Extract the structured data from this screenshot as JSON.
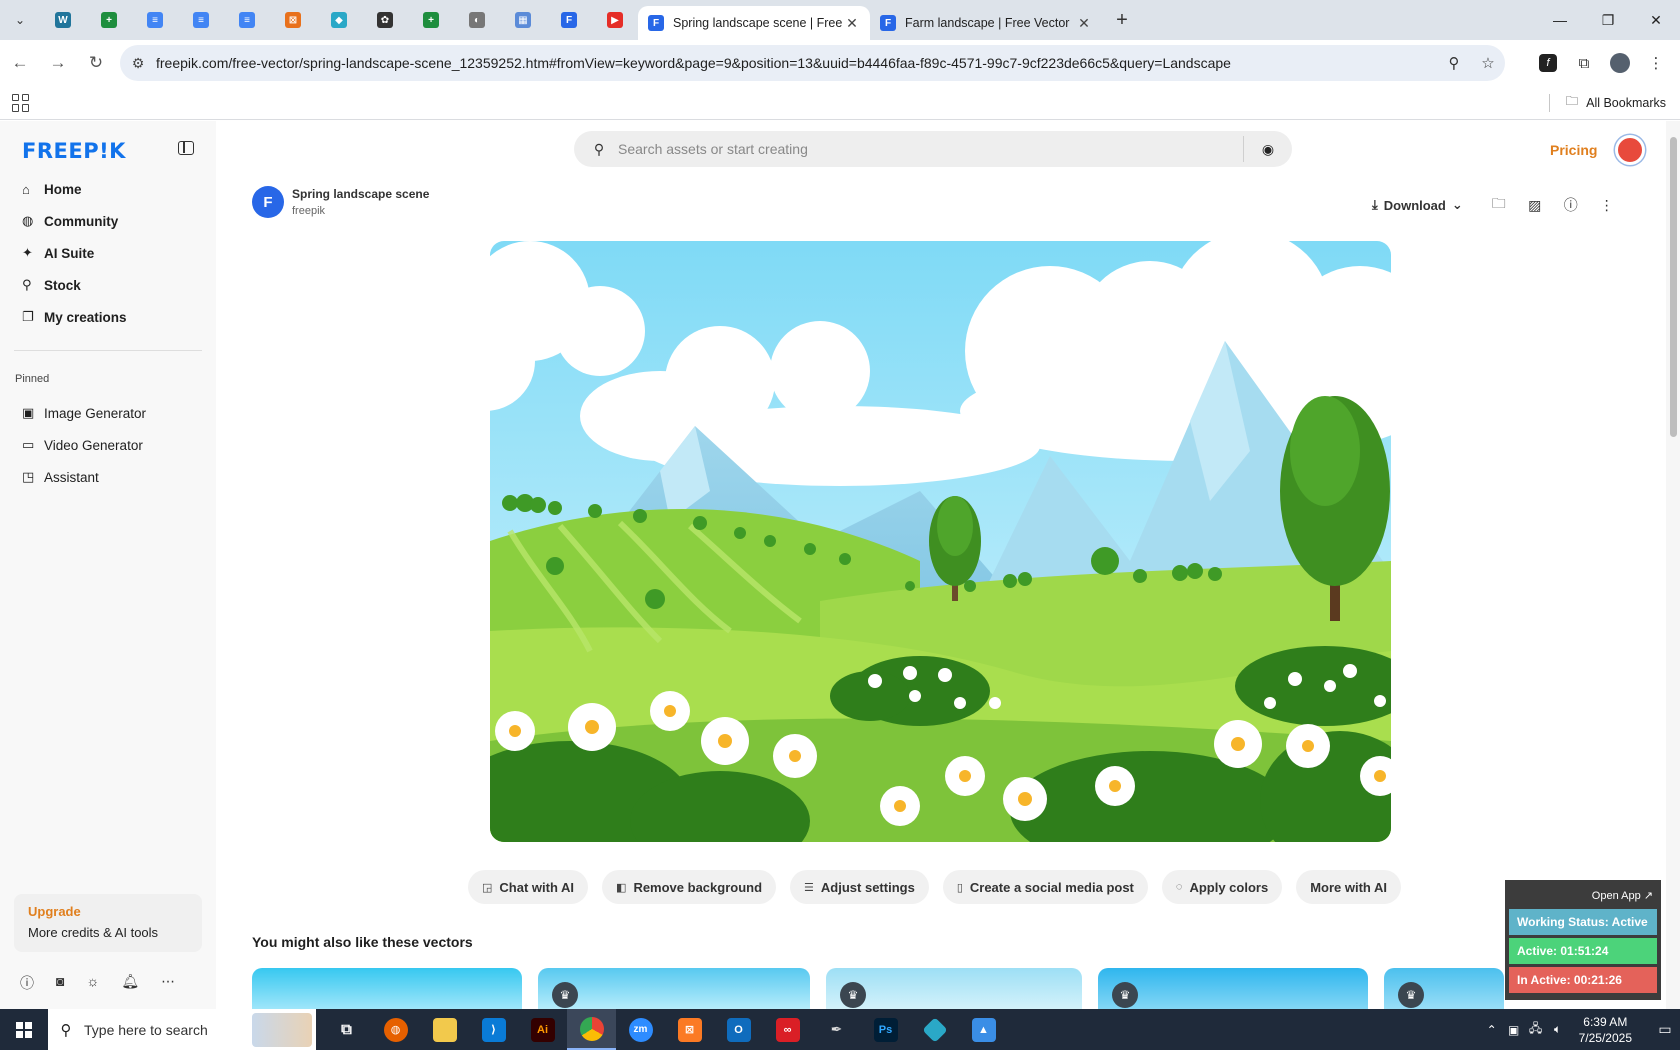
{
  "browser": {
    "pinned_tabs": [
      {
        "icon": "wordpress-icon",
        "color": "#21759b",
        "glyph": "W"
      },
      {
        "icon": "google-sheets-icon",
        "color": "#1e8e3e",
        "glyph": "+"
      },
      {
        "icon": "google-docs-icon",
        "color": "#4285f4",
        "glyph": "≡"
      },
      {
        "icon": "google-docs-icon",
        "color": "#4285f4",
        "glyph": "≡"
      },
      {
        "icon": "google-docs-icon",
        "color": "#4285f4",
        "glyph": "≡"
      },
      {
        "icon": "xampp-icon",
        "color": "#e8711c",
        "glyph": "⊠"
      },
      {
        "icon": "app-icon",
        "color": "#2aa8c7",
        "glyph": "◆"
      },
      {
        "icon": "chatgpt-icon",
        "color": "#333333",
        "glyph": "✿"
      },
      {
        "icon": "google-sheets-icon",
        "color": "#1e8e3e",
        "glyph": "+"
      },
      {
        "icon": "globe-icon",
        "color": "#777777",
        "glyph": "◐"
      },
      {
        "icon": "grid-app-icon",
        "color": "#5b8bd8",
        "glyph": "▦"
      },
      {
        "icon": "freepik-icon",
        "color": "#2867e7",
        "glyph": "F"
      },
      {
        "icon": "youtube-icon",
        "color": "#e52d27",
        "glyph": "▶"
      }
    ],
    "tabs": [
      {
        "title": "Spring landscape scene | Free V",
        "active": true
      },
      {
        "title": "Farm landscape | Free Vector",
        "active": false
      }
    ],
    "url": "freepik.com/free-vector/spring-landscape-scene_12359252.htm#fromView=keyword&page=9&position=13&uuid=b4446faa-f89c-4571-99c7-9cf223de66c5&query=Landscape",
    "all_bookmarks": "All Bookmarks"
  },
  "sidebar": {
    "logo": "FREEP!K",
    "nav": [
      {
        "label": "Home",
        "icon": "home-icon",
        "glyph": "⌂"
      },
      {
        "label": "Community",
        "icon": "globe-icon",
        "glyph": "◍"
      },
      {
        "label": "AI Suite",
        "icon": "sparkle-icon",
        "glyph": "✦"
      },
      {
        "label": "Stock",
        "icon": "search-icon",
        "glyph": "⚲"
      },
      {
        "label": "My creations",
        "icon": "creations-icon",
        "glyph": "❐"
      }
    ],
    "pinned_label": "Pinned",
    "pinned": [
      {
        "label": "Image Generator",
        "icon": "image-icon",
        "glyph": "▣"
      },
      {
        "label": "Video Generator",
        "icon": "video-icon",
        "glyph": "▭"
      },
      {
        "label": "Assistant",
        "icon": "chat-icon",
        "glyph": "◳"
      }
    ],
    "upgrade_title": "Upgrade",
    "upgrade_text": "More credits & AI tools"
  },
  "header": {
    "search_placeholder": "Search assets or start creating",
    "pricing": "Pricing"
  },
  "asset": {
    "title": "Spring landscape scene",
    "author": "freepik",
    "download": "Download"
  },
  "ai_actions": [
    {
      "label": "Chat with AI",
      "icon": "chat-icon",
      "glyph": "◲"
    },
    {
      "label": "Remove background",
      "icon": "remove-bg-icon",
      "glyph": "◧"
    },
    {
      "label": "Adjust settings",
      "icon": "sliders-icon",
      "glyph": "☰"
    },
    {
      "label": "Create a social media post",
      "icon": "phone-icon",
      "glyph": "▯"
    },
    {
      "label": "Apply colors",
      "icon": "palette-icon",
      "glyph": "◌"
    },
    {
      "label": "More with AI",
      "icon": "",
      "glyph": ""
    }
  ],
  "similar_heading": "You might also like these vectors",
  "tracker": {
    "open_app": "Open App ↗",
    "status": "Working Status: Active",
    "active": "Active: 01:51:24",
    "inactive": "In Active: 00:21:26",
    "colors": {
      "status": "#5fb3c9",
      "active": "#4cd37a",
      "inactive": "#e4625a"
    }
  },
  "taskbar": {
    "search_placeholder": "Type here to search",
    "time": "6:39 AM",
    "date": "7/25/2025"
  }
}
